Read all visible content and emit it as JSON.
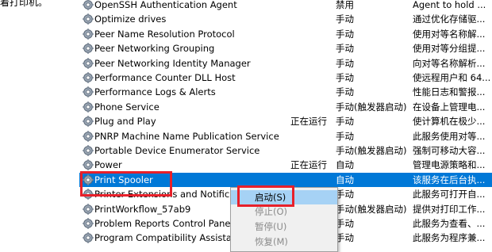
{
  "left_fragment": "着打印机。",
  "services": [
    {
      "name": "OpenSSH Authentication Agent",
      "status": "",
      "startup": "禁用",
      "desc": "Agent to hold ..."
    },
    {
      "name": "Optimize drives",
      "status": "",
      "startup": "手动",
      "desc": "通过优化存储驱..."
    },
    {
      "name": "Peer Name Resolution Protocol",
      "status": "",
      "startup": "手动",
      "desc": "使用对等名称解..."
    },
    {
      "name": "Peer Networking Grouping",
      "status": "",
      "startup": "手动",
      "desc": "使用对等分组提..."
    },
    {
      "name": "Peer Networking Identity Manager",
      "status": "",
      "startup": "手动",
      "desc": "向对等名称解析..."
    },
    {
      "name": "Performance Counter DLL Host",
      "status": "",
      "startup": "手动",
      "desc": "使远程用户和 64..."
    },
    {
      "name": "Performance Logs & Alerts",
      "status": "",
      "startup": "手动",
      "desc": "性能日志和警报..."
    },
    {
      "name": "Phone Service",
      "status": "",
      "startup": "手动(触发器启动)",
      "desc": "在设备上管理电..."
    },
    {
      "name": "Plug and Play",
      "status": "正在运行",
      "startup": "手动",
      "desc": "使计算机在极少..."
    },
    {
      "name": "PNRP Machine Name Publication Service",
      "status": "",
      "startup": "手动",
      "desc": "此服务使用对等..."
    },
    {
      "name": "Portable Device Enumerator Service",
      "status": "",
      "startup": "手动(触发器启动)",
      "desc": "强制可移动大容..."
    },
    {
      "name": "Power",
      "status": "正在运行",
      "startup": "自动",
      "desc": "管理电源策略和..."
    },
    {
      "name": "Print Spooler",
      "status": "",
      "startup": "自动",
      "desc": "该服务在后台执..."
    },
    {
      "name": "Printer Extensions and Notifications",
      "status": "",
      "startup": "手动",
      "desc": "此服务可打开自..."
    },
    {
      "name": "PrintWorkflow_57ab9",
      "status": "",
      "startup": "手动(触发器启动)",
      "desc": "提供对打印工作..."
    },
    {
      "name": "Problem Reports Control Panel Support",
      "status": "",
      "startup": "手动",
      "desc": "此服务为查看、..."
    },
    {
      "name": "Program Compatibility Assistant Service",
      "status": "",
      "startup": "手动",
      "desc": "此服务为程序兼..."
    }
  ],
  "context_menu": {
    "items": [
      {
        "label": "启动(S)",
        "state": "hover"
      },
      {
        "label": "停止(O)",
        "state": "disabled"
      },
      {
        "label": "暂停(U)",
        "state": "disabled"
      },
      {
        "label": "恢复(M)",
        "state": "disabled"
      }
    ]
  },
  "colors": {
    "selection": "#0078d7",
    "highlight_box": "#e8202a",
    "menu_hover": "#a6d2f5"
  }
}
